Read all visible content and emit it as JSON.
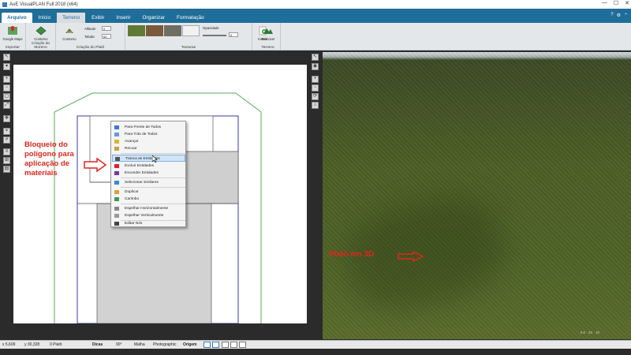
{
  "window": {
    "title": "AuE VisualPLAN Full 2018 (x64)",
    "controls": [
      "—",
      "☐",
      "✕"
    ]
  },
  "tabs": [
    {
      "label": "Arquivo"
    },
    {
      "label": "Início"
    },
    {
      "label": "Terreno"
    },
    {
      "label": "Exibir"
    },
    {
      "label": "Inserir"
    },
    {
      "label": "Organizar"
    },
    {
      "label": "Formatação"
    }
  ],
  "ribbon": {
    "groups": [
      {
        "label": "Importar",
        "buttons": [
          "Google Maps"
        ]
      },
      {
        "label": "Criação do Moreno",
        "buttons": [
          "Contorno"
        ]
      },
      {
        "label": "Criação do Platô",
        "buttons": [
          "Contorno"
        ],
        "fields": [
          {
            "label": "Altitude",
            "value": "0"
          },
          {
            "label": "Taluda",
            "value": "60"
          }
        ]
      },
      {
        "label": "Texturas",
        "fields": [
          {
            "label": "Opacidade",
            "value": "0"
          }
        ]
      },
      {
        "label": "Terreno",
        "buttons": [
          "Inserir"
        ]
      },
      {
        "label": "Terreno",
        "buttons": [
          "Remover"
        ]
      }
    ]
  },
  "context_menu": {
    "items": [
      {
        "label": "Para Frente de Todos",
        "icon": "bring-front-icon"
      },
      {
        "label": "Para Trás de Todos",
        "icon": "send-back-icon"
      },
      {
        "label": "Avançar",
        "icon": "forward-icon"
      },
      {
        "label": "Recuar",
        "icon": "backward-icon"
      },
      {
        "label": "Tranca as Entidades",
        "icon": "lock-icon",
        "highlight": true
      },
      {
        "label": "Excluir Entidades",
        "icon": "delete-icon"
      },
      {
        "label": "Esconder Entidades",
        "icon": "hide-icon"
      },
      {
        "label": "Selecionar similares",
        "icon": "select-similar-icon"
      },
      {
        "label": "Duplicar",
        "icon": "duplicate-icon"
      },
      {
        "label": "Carimbo",
        "icon": "stamp-icon"
      },
      {
        "label": "Espelhar Horizontalmente",
        "icon": "mirror-h-icon"
      },
      {
        "label": "Espelhar Verticalmente",
        "icon": "mirror-v-icon"
      },
      {
        "label": "Editar Nós",
        "icon": "edit-nodes-icon"
      }
    ]
  },
  "annotations": {
    "left": "Bloqueio do polígono para aplicação de materiais",
    "right": "Platô em 3D"
  },
  "view3d": {
    "coord": "0.0  ·  20  ·  10"
  },
  "status": {
    "x": "x 5,609",
    "y": "y 30,328",
    "platos": "0 Platô",
    "dicas": "Dicas",
    "angle": "90°",
    "malha": "Malha",
    "photo": "Photographic",
    "origem": "Origem"
  },
  "colors": {
    "accent": "#1f6e99",
    "annotation": "#e0261b",
    "grass": "#4e6326"
  }
}
